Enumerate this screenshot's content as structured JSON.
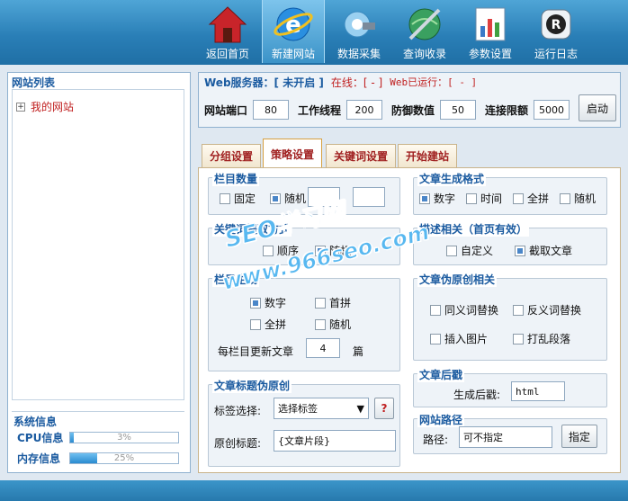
{
  "nav": [
    {
      "label": "返回首页",
      "icon": "home-icon"
    },
    {
      "label": "新建网站",
      "icon": "ie-globe-icon"
    },
    {
      "label": "数据采集",
      "icon": "satellite-icon"
    },
    {
      "label": "查询收录",
      "icon": "search-globe-icon"
    },
    {
      "label": "参数设置",
      "icon": "chart-icon"
    },
    {
      "label": "运行日志",
      "icon": "log-icon"
    }
  ],
  "left": {
    "title": "网站列表",
    "tree_item": "我的网站",
    "tree_expand": "+",
    "sysinfo_title": "系统信息",
    "cpu_label": "CPU信息",
    "cpu_value": "3%",
    "cpu_fraction": 0.03,
    "mem_label": "内存信息",
    "mem_value": "25%",
    "mem_fraction": 0.25
  },
  "server": {
    "title": "Web服务器：[ 未开启 ]",
    "online": "在线：[ - ]",
    "running": "Web已运行：[ - ]",
    "port_label": "网站端口",
    "port_value": "80",
    "threads_label": "工作线程",
    "threads_value": "200",
    "defense_label": "防御数值",
    "defense_value": "50",
    "conn_label": "连接限额",
    "conn_value": "5000",
    "start_button": "启动"
  },
  "tabs": [
    "分组设置",
    "策略设置",
    "关键词设置",
    "开始建站"
  ],
  "strategy": {
    "column_count": {
      "title": "栏目数量",
      "fixed": "固定",
      "random": "随机"
    },
    "keyword_mode": {
      "title": "关键词提取方式",
      "order": "顺序",
      "random": "随机"
    },
    "column_gen": {
      "title": "栏目生成",
      "digit": "数字",
      "initials": "首拼",
      "full": "全拼",
      "random": "随机",
      "per_column_label": "每栏目更新文章",
      "per_column_value": "4",
      "unit": "篇"
    },
    "title_pseudo": {
      "title": "文章标题伪原创",
      "tag_label": "标签选择:",
      "tag_value": "选择标签",
      "help": "?",
      "orig_label": "原创标题:",
      "orig_value": "{文章片段}"
    },
    "article_format": {
      "title": "文章生成格式",
      "digit": "数字",
      "time": "时间",
      "full": "全拼",
      "random": "随机"
    },
    "desc": {
      "title": "描述相关（首页有效）",
      "custom": "自定义",
      "excerpt": "截取文章"
    },
    "article_pseudo": {
      "title": "文章伪原创相关",
      "synonym": "同义词替换",
      "antonym": "反义词替换",
      "insert_image": "插入图片",
      "shuffle": "打乱段落"
    },
    "suffix": {
      "title": "文章后戳",
      "label": "生成后戳:",
      "value": "html"
    },
    "path": {
      "title": "网站路径",
      "label": "路径:",
      "value": "可不指定",
      "button": "指定"
    }
  },
  "watermark": {
    "line1": "SEO学习网",
    "line2": "www.966seo.com"
  }
}
